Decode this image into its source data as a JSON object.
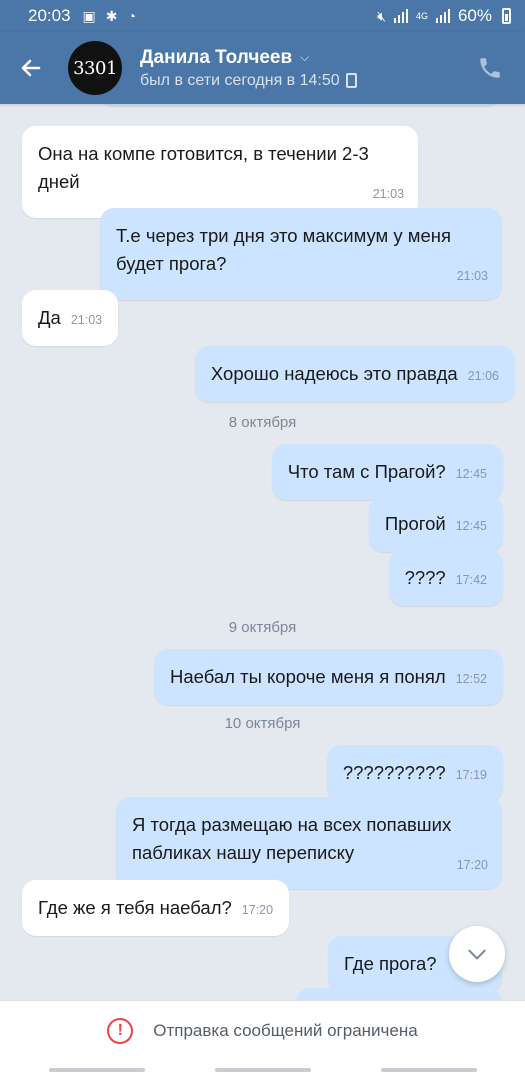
{
  "status_bar": {
    "time": "20:03",
    "battery": "60%",
    "network_label": "4G"
  },
  "header": {
    "back_icon": "arrow-left-icon",
    "avatar_text": "3301",
    "name": "Данила Толчеев",
    "status": "был в сети сегодня в 14:50",
    "call_icon": "phone-icon"
  },
  "messages": [
    {
      "dir": "in",
      "text": "Она на компе готовится, в течении 2-3 дней",
      "time": "21:03"
    },
    {
      "dir": "out",
      "text": "Т.е через три дня это максимум у меня будет прога?",
      "time": "21:03"
    },
    {
      "dir": "in",
      "text": "Да",
      "time": "21:03"
    },
    {
      "dir": "out",
      "text": "Хорошо надеюсь это правда",
      "time": "21:06"
    },
    {
      "dir": "out",
      "text": "Что там с Прагой?",
      "time": "12:45"
    },
    {
      "dir": "out",
      "text": "Прогой",
      "time": "12:45"
    },
    {
      "dir": "out",
      "text": "????",
      "time": "17:42"
    },
    {
      "dir": "out",
      "text": "Наебал ты короче меня я понял",
      "time": "12:52"
    },
    {
      "dir": "out",
      "text": "??????????",
      "time": "17:19"
    },
    {
      "dir": "out",
      "text": "Я тогда размещаю на всех попавших пабликах нашу переписку",
      "time": "17:20"
    },
    {
      "dir": "in",
      "text": "Где же я тебя наебал?",
      "time": "17:20"
    },
    {
      "dir": "out",
      "text": "Где прога?",
      "time": ""
    }
  ],
  "date_separators": [
    "8 октября",
    "9 октября",
    "10 октября"
  ],
  "bottom": {
    "restriction_text": "Отправка сообщений ограничена",
    "warning_icon": "warning-circle-icon"
  },
  "colors": {
    "header": "#4a76a8",
    "incoming_bubble": "#ffffff",
    "outgoing_bubble": "#cce4ff",
    "background": "#e4e9ef",
    "warning": "#e64646"
  }
}
